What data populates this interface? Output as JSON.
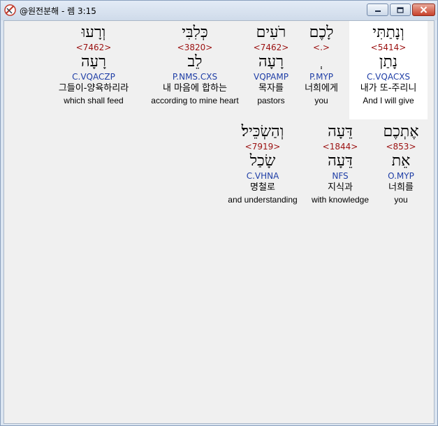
{
  "window": {
    "title": "@원전분해 - 렘 3:15"
  },
  "colors": {
    "strong": "#9b1010",
    "parse": "#1f3ea6",
    "selected_background": "#ffffff"
  },
  "row1": [
    {
      "hebrew": "וְנָתַתִּי",
      "strong": "<5414>",
      "lemma": "נָתַן",
      "parse": "C.VQACXS",
      "korean": "내가 또-주리니",
      "english": "And I will give"
    },
    {
      "hebrew": "לָכֶם",
      "strong": "<.>",
      "lemma": "ְ",
      "parse": "P.MYP",
      "korean": "너희에게",
      "english": "you"
    },
    {
      "hebrew": "רֹעִים",
      "strong": "<7462>",
      "lemma": "רָעָה",
      "parse": "VQPAMP",
      "korean": "목자를",
      "english": "pastors"
    },
    {
      "hebrew": "כְּלִבִּי",
      "strong": "<3820>",
      "lemma": "לֵב",
      "parse": "P.NMS.CXS",
      "korean": "내 마음에 합하는",
      "english": "according to mine heart"
    },
    {
      "hebrew": "וְרָעוּ",
      "strong": "<7462>",
      "lemma": "רָעָה",
      "parse": "C.VQACZP",
      "korean": "그들이-양육하리라",
      "english": "which shall feed"
    }
  ],
  "row2": [
    {
      "hebrew": "אֶתְכֶם",
      "strong": "<853>",
      "lemma": "אֵת",
      "parse": "O.MYP",
      "korean": "너희를",
      "english": "you"
    },
    {
      "hebrew": "דֵּעָה",
      "strong": "<1844>",
      "lemma": "דֵּעָה",
      "parse": "NFS",
      "korean": "지식과",
      "english": "with knowledge"
    },
    {
      "hebrew": "וְהַשְׂכֵּיל׃",
      "strong": "<7919>",
      "lemma": "שָׂכַל",
      "parse": "C.VHNA",
      "korean": "명철로",
      "english": "and understanding"
    }
  ]
}
